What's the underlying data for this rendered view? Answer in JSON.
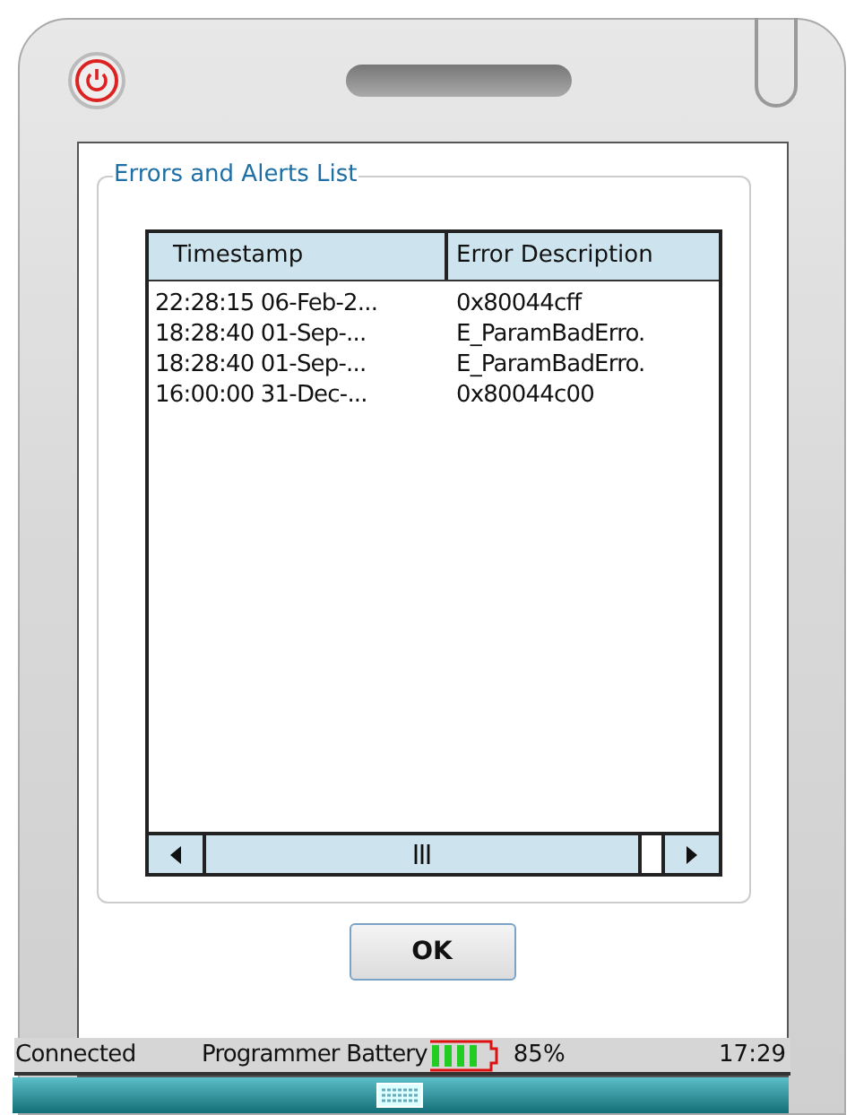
{
  "dialog": {
    "title": "Errors and Alerts List"
  },
  "table": {
    "columns": [
      "Timestamp",
      "Error Description"
    ],
    "rows": [
      [
        "22:28:15 06-Feb-2...",
        "0x80044cff"
      ],
      [
        "18:28:40 01-Sep-...",
        "E_ParamBadErro."
      ],
      [
        "18:28:40 01-Sep-...",
        "E_ParamBadErro."
      ],
      [
        "16:00:00 31-Dec-...",
        "0x80044c00"
      ]
    ]
  },
  "buttons": [
    "OK"
  ],
  "status_bar": {
    "connection": "Connected",
    "battery_label": "Programmer Battery",
    "battery_percent": "85%",
    "time": "17:29"
  }
}
